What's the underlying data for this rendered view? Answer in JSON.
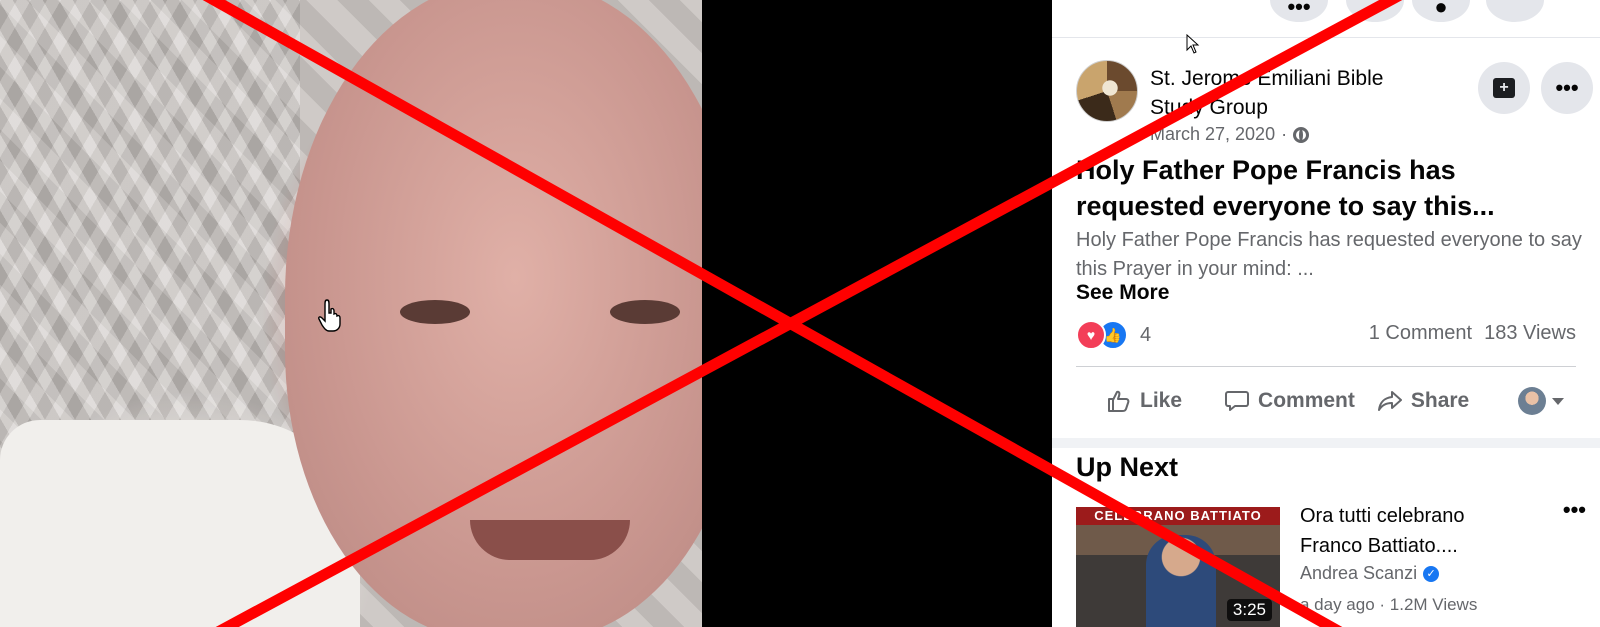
{
  "post": {
    "page_name": "St. Jerome Emiliani Bible Study Group",
    "date": "March 27, 2020",
    "separator": "·",
    "title": "Holy Father Pope Francis has requested everyone to say this...",
    "excerpt": "Holy Father Pope Francis has requested everyone to say this Prayer in your mind: ...",
    "see_more": "See More",
    "reaction_count": "4",
    "comments": "1 Comment",
    "views": "183 Views"
  },
  "actions": {
    "like": "Like",
    "comment": "Comment",
    "share": "Share"
  },
  "nav": {
    "more_glyph": "•••"
  },
  "up_next": {
    "heading": "Up Next",
    "cards": [
      {
        "title": "Ora tutti celebrano Franco Battiato....",
        "author": "Andrea Scanzi",
        "meta": "a day ago · 1.2M Views",
        "duration": "3:25",
        "thumb_banner": "CELEBRANO BATTIATO",
        "more": "•••"
      }
    ]
  },
  "colors": {
    "overlay_x": "#ff0000",
    "fb_blue": "#1877f2",
    "love_red": "#f33e58",
    "secondary_text": "#65676b"
  }
}
